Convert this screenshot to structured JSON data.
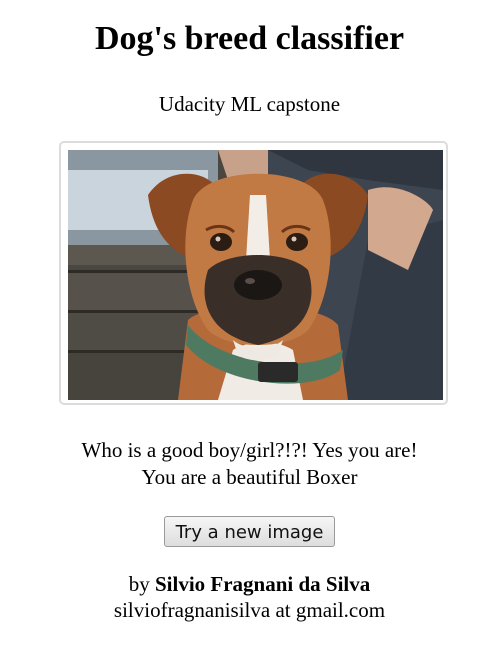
{
  "header": {
    "title": "Dog's breed classifier",
    "subtitle": "Udacity ML capstone"
  },
  "image": {
    "alt": "Boxer dog photo",
    "frame_border_color": "#dcdcdc"
  },
  "result": {
    "line1": "Who is a good boy/girl?!?! Yes you are!",
    "line2": "You are a beautiful Boxer"
  },
  "actions": {
    "new_image_label": "Try a new image"
  },
  "footer": {
    "by_prefix": "by",
    "author": "Silvio Fragnani da Silva",
    "email": "silviofragnanisilva at gmail.com"
  }
}
